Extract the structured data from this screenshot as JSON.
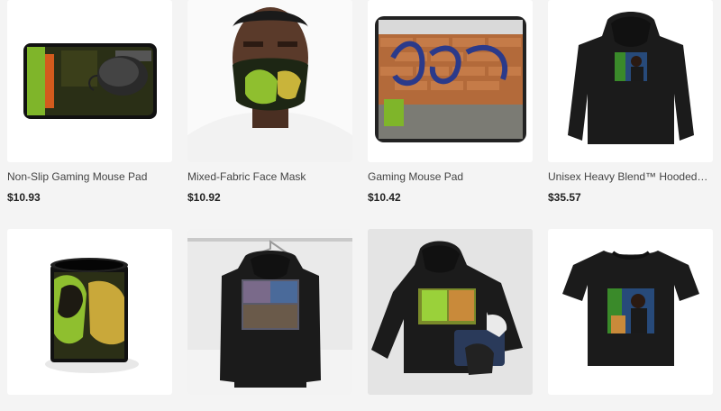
{
  "products": [
    {
      "title": "Non-Slip Gaming Mouse Pad",
      "price": "$10.93",
      "image": "mouse-pad-with-mouse-image"
    },
    {
      "title": "Mixed-Fabric Face Mask",
      "price": "$10.92",
      "image": "face-mask-model-image"
    },
    {
      "title": "Gaming Mouse Pad",
      "price": "$10.42",
      "image": "graffiti-mouse-pad-image"
    },
    {
      "title": "Unisex Heavy Blend™ Hooded S...",
      "price": "$35.57",
      "image": "black-hoodie-image"
    },
    {
      "image": "black-mug-image"
    },
    {
      "image": "hoodie-on-hanger-image"
    },
    {
      "image": "hoodie-flatlay-image"
    },
    {
      "image": "black-tshirt-image"
    }
  ],
  "colors": {
    "background": "#f4f4f4",
    "card": "#ffffff",
    "graffiti_green": "#9ad13a",
    "garment": "#1b1b1b"
  }
}
